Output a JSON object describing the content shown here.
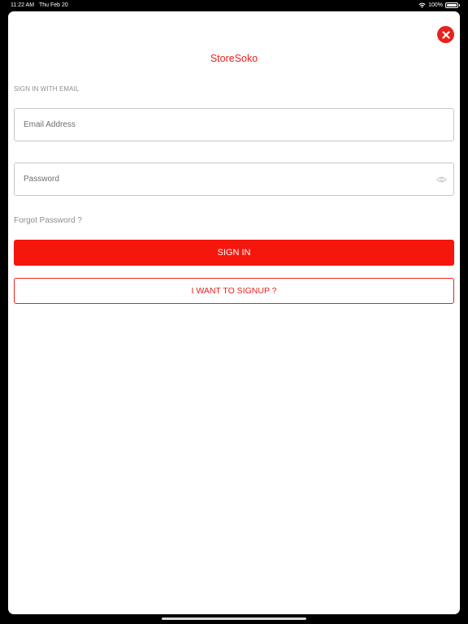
{
  "status_bar": {
    "time": "11:22 AM",
    "date": "Thu Feb 20",
    "battery": "100%",
    "battery_level": 1.0,
    "wifi_icon": "wifi-icon",
    "battery_icon": "battery-icon"
  },
  "sheet": {
    "app_title": "StoreSoko",
    "section_label": "SIGN IN WITH EMAIL",
    "email": {
      "placeholder": "Email Address",
      "value": ""
    },
    "password": {
      "placeholder": "Password",
      "value": "",
      "toggle_icon": "eye-icon"
    },
    "forgot_password": "Forgot Password ?",
    "sign_in_label": "SIGN IN",
    "sign_up_label": "I WANT TO SIGNUP ?",
    "close_icon": "close-icon"
  },
  "colors": {
    "accent": "#e8211c",
    "sign_in_button": "#f5160d",
    "muted_text": "#8e8e93",
    "border": "#c7c7cc"
  }
}
